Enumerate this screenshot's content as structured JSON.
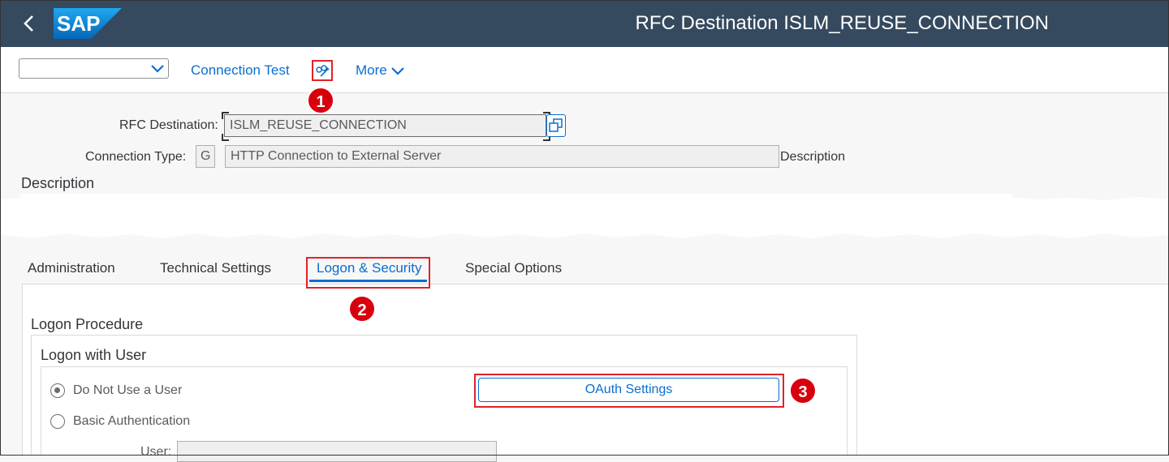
{
  "shell": {
    "title": "RFC Destination ISLM_REUSE_CONNECTION",
    "logo_text": "SAP",
    "brand_color": "#354a5f"
  },
  "toolbar": {
    "dropdown_value": "",
    "connection_test": "Connection Test",
    "edit_icon": "edit-glasses-icon",
    "more": "More"
  },
  "header": {
    "rfc_destination_label": "RFC Destination:",
    "rfc_destination_value": "ISLM_REUSE_CONNECTION",
    "connection_type_label": "Connection Type:",
    "connection_type_code": "G",
    "connection_type_value": "HTTP Connection to External Server",
    "description_suffix": "Description"
  },
  "description": {
    "heading": "Description"
  },
  "tabs": [
    {
      "label": "Administration",
      "active": false
    },
    {
      "label": "Technical Settings",
      "active": false
    },
    {
      "label": "Logon & Security",
      "active": true
    },
    {
      "label": "Special Options",
      "active": false
    }
  ],
  "logon": {
    "procedure_heading": "Logon Procedure",
    "with_user_heading": "Logon with User",
    "options": [
      {
        "label": "Do Not Use a User",
        "selected": true
      },
      {
        "label": "Basic Authentication",
        "selected": false
      }
    ],
    "user_label": "User:",
    "user_value": "",
    "oauth_button": "OAuth Settings"
  },
  "annotations": {
    "step1": "1",
    "step2": "2",
    "step3": "3",
    "highlight_color": "#e0222a"
  }
}
